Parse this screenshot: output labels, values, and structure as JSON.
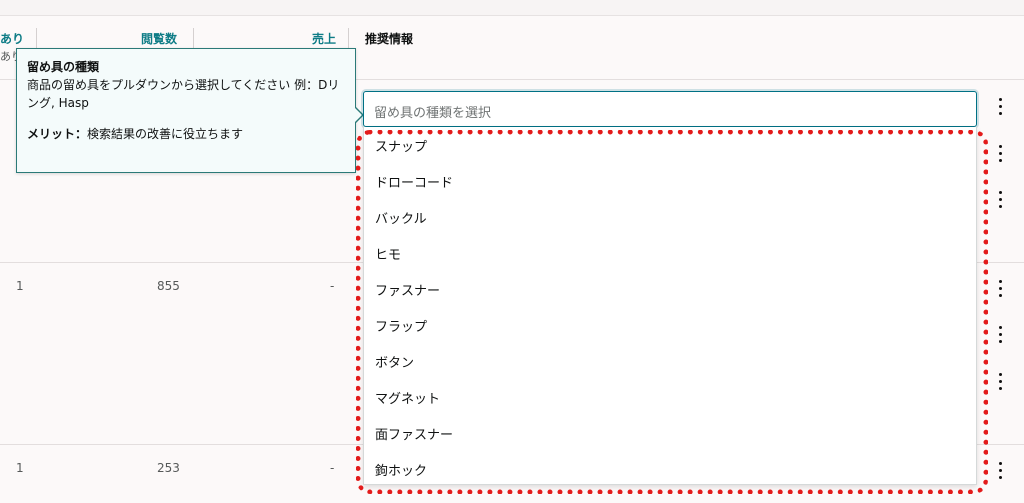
{
  "header": {
    "col_ari": "あり",
    "col_ari_sub": "あり",
    "col_views": "閲覧数",
    "col_sales": "売上",
    "col_recommended": "推奨情報"
  },
  "rows": [
    {
      "num": "1",
      "views": "855",
      "sales": "-"
    },
    {
      "num": "1",
      "views": "253",
      "sales": "-"
    }
  ],
  "tooltip": {
    "title": "留め具の種類",
    "body": "商品の留め具をプルダウンから選択してください 例：Dリング, Hasp",
    "merit_label": "メリット：",
    "merit_text": "検索結果の改善に役立ちます"
  },
  "select": {
    "placeholder": "留め具の種類を選択",
    "options": [
      "スナップ",
      "ドローコード",
      "バックル",
      "ヒモ",
      "ファスナー",
      "フラップ",
      "ボタン",
      "マグネット",
      "面ファスナー",
      "鉤ホック"
    ]
  },
  "icons": {
    "row_menu": "more-vertical-icon"
  },
  "colors": {
    "accent": "#0e7c86",
    "highlight": "#e31b1b",
    "tooltip_border": "#2b7a78"
  }
}
